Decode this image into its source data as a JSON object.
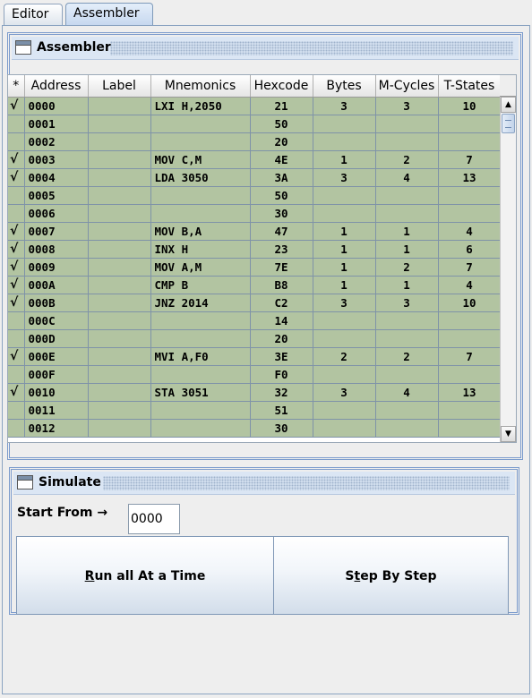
{
  "tabs": [
    {
      "label": "Editor",
      "active": false
    },
    {
      "label": "Assembler",
      "active": true
    }
  ],
  "assembler_frame": {
    "title": "Assembler"
  },
  "table": {
    "columns": [
      "*",
      "Address",
      "Label",
      "Mnemonics",
      "Hexcode",
      "Bytes",
      "M-Cycles",
      "T-States"
    ],
    "rows": [
      {
        "check": "√",
        "address": "0000",
        "label": "",
        "mnemonic": "LXI H,2050",
        "hex": "21",
        "bytes": "3",
        "mcycles": "3",
        "tstates": "10"
      },
      {
        "check": "",
        "address": "0001",
        "label": "",
        "mnemonic": "",
        "hex": "50",
        "bytes": "",
        "mcycles": "",
        "tstates": ""
      },
      {
        "check": "",
        "address": "0002",
        "label": "",
        "mnemonic": "",
        "hex": "20",
        "bytes": "",
        "mcycles": "",
        "tstates": ""
      },
      {
        "check": "√",
        "address": "0003",
        "label": "",
        "mnemonic": "MOV C,M",
        "hex": "4E",
        "bytes": "1",
        "mcycles": "2",
        "tstates": "7"
      },
      {
        "check": "√",
        "address": "0004",
        "label": "",
        "mnemonic": "LDA 3050",
        "hex": "3A",
        "bytes": "3",
        "mcycles": "4",
        "tstates": "13"
      },
      {
        "check": "",
        "address": "0005",
        "label": "",
        "mnemonic": "",
        "hex": "50",
        "bytes": "",
        "mcycles": "",
        "tstates": ""
      },
      {
        "check": "",
        "address": "0006",
        "label": "",
        "mnemonic": "",
        "hex": "30",
        "bytes": "",
        "mcycles": "",
        "tstates": ""
      },
      {
        "check": "√",
        "address": "0007",
        "label": "",
        "mnemonic": "MOV B,A",
        "hex": "47",
        "bytes": "1",
        "mcycles": "1",
        "tstates": "4"
      },
      {
        "check": "√",
        "address": "0008",
        "label": "",
        "mnemonic": "INX H",
        "hex": "23",
        "bytes": "1",
        "mcycles": "1",
        "tstates": "6"
      },
      {
        "check": "√",
        "address": "0009",
        "label": "",
        "mnemonic": "MOV A,M",
        "hex": "7E",
        "bytes": "1",
        "mcycles": "2",
        "tstates": "7"
      },
      {
        "check": "√",
        "address": "000A",
        "label": "",
        "mnemonic": "CMP B",
        "hex": "B8",
        "bytes": "1",
        "mcycles": "1",
        "tstates": "4"
      },
      {
        "check": "√",
        "address": "000B",
        "label": "",
        "mnemonic": "JNZ 2014",
        "hex": "C2",
        "bytes": "3",
        "mcycles": "3",
        "tstates": "10"
      },
      {
        "check": "",
        "address": "000C",
        "label": "",
        "mnemonic": "",
        "hex": "14",
        "bytes": "",
        "mcycles": "",
        "tstates": ""
      },
      {
        "check": "",
        "address": "000D",
        "label": "",
        "mnemonic": "",
        "hex": "20",
        "bytes": "",
        "mcycles": "",
        "tstates": ""
      },
      {
        "check": "√",
        "address": "000E",
        "label": "",
        "mnemonic": "MVI A,F0",
        "hex": "3E",
        "bytes": "2",
        "mcycles": "2",
        "tstates": "7"
      },
      {
        "check": "",
        "address": "000F",
        "label": "",
        "mnemonic": "",
        "hex": "F0",
        "bytes": "",
        "mcycles": "",
        "tstates": ""
      },
      {
        "check": "√",
        "address": "0010",
        "label": "",
        "mnemonic": "STA 3051",
        "hex": "32",
        "bytes": "3",
        "mcycles": "4",
        "tstates": "13"
      },
      {
        "check": "",
        "address": "0011",
        "label": "",
        "mnemonic": "",
        "hex": "51",
        "bytes": "",
        "mcycles": "",
        "tstates": ""
      },
      {
        "check": "",
        "address": "0012",
        "label": "",
        "mnemonic": "",
        "hex": "30",
        "bytes": "",
        "mcycles": "",
        "tstates": ""
      }
    ]
  },
  "simulate_frame": {
    "title": "Simulate",
    "start_from_label": "Start From →",
    "start_from_value": "0000",
    "run_all_label": "Run all At a Time",
    "step_label": "Step By Step"
  },
  "colors": {
    "row_bg": "#b2c4a1",
    "frame_border": "#7b9bcc"
  }
}
